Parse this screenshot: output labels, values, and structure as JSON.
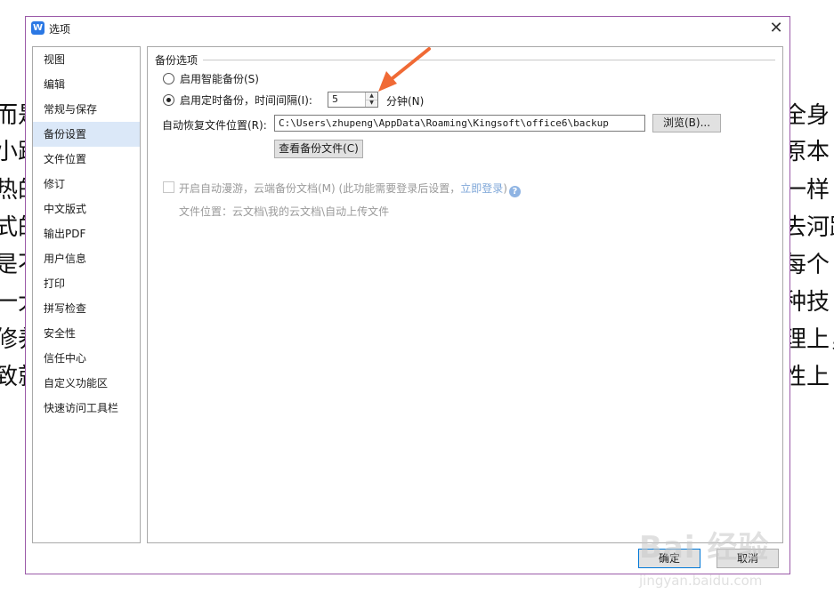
{
  "background_doc": {
    "left_fragments": [
      "而是",
      "小跳",
      "热的",
      "式的",
      "是不",
      "一大",
      "修养",
      "致就"
    ],
    "right_fragments": [
      "全身",
      "原本",
      "一样",
      "去河路",
      "每个",
      "种技",
      "理上，",
      "性上"
    ]
  },
  "dialog": {
    "title": "选项",
    "close_glyph": "✕"
  },
  "sidebar": {
    "items": [
      {
        "label": "视图",
        "active": false
      },
      {
        "label": "编辑",
        "active": false
      },
      {
        "label": "常规与保存",
        "active": false
      },
      {
        "label": "备份设置",
        "active": true
      },
      {
        "label": "文件位置",
        "active": false
      },
      {
        "label": "修订",
        "active": false
      },
      {
        "label": "中文版式",
        "active": false
      },
      {
        "label": "输出PDF",
        "active": false
      },
      {
        "label": "用户信息",
        "active": false
      },
      {
        "label": "打印",
        "active": false
      },
      {
        "label": "拼写检查",
        "active": false
      },
      {
        "label": "安全性",
        "active": false
      },
      {
        "label": "信任中心",
        "active": false
      },
      {
        "label": "自定义功能区",
        "active": false
      },
      {
        "label": "快速访问工具栏",
        "active": false
      }
    ]
  },
  "backup": {
    "group_title": "备份选项",
    "smart_backup_label": "启用智能备份(S)",
    "timed_backup_label": "启用定时备份，时间间隔(I):",
    "interval_value": "5",
    "interval_unit": "分钟(N)",
    "recovery_location_label": "自动恢复文件位置(R):",
    "recovery_path": "C:\\Users\\zhupeng\\AppData\\Roaming\\Kingsoft\\office6\\backup",
    "browse_button": "浏览(B)...",
    "view_backup_button": "查看备份文件(C)",
    "cloud_label": "开启自动漫游，云端备份文档(M) (此功能需要登录后设置，",
    "cloud_login_link": "立即登录",
    "cloud_close_paren": ")",
    "cloud_location": "文件位置：云文档\\我的云文档\\自动上传文件"
  },
  "footer": {
    "ok_button": "确定",
    "cancel_button": "取消"
  },
  "watermark": {
    "big": "Bai 经验",
    "small": "jingyan.baidu.com"
  },
  "colors": {
    "dialog_border": "#9b5aa8",
    "active_item_bg": "#dbe8f8",
    "arrow": "#f06a35",
    "link": "#7fa7d8"
  }
}
